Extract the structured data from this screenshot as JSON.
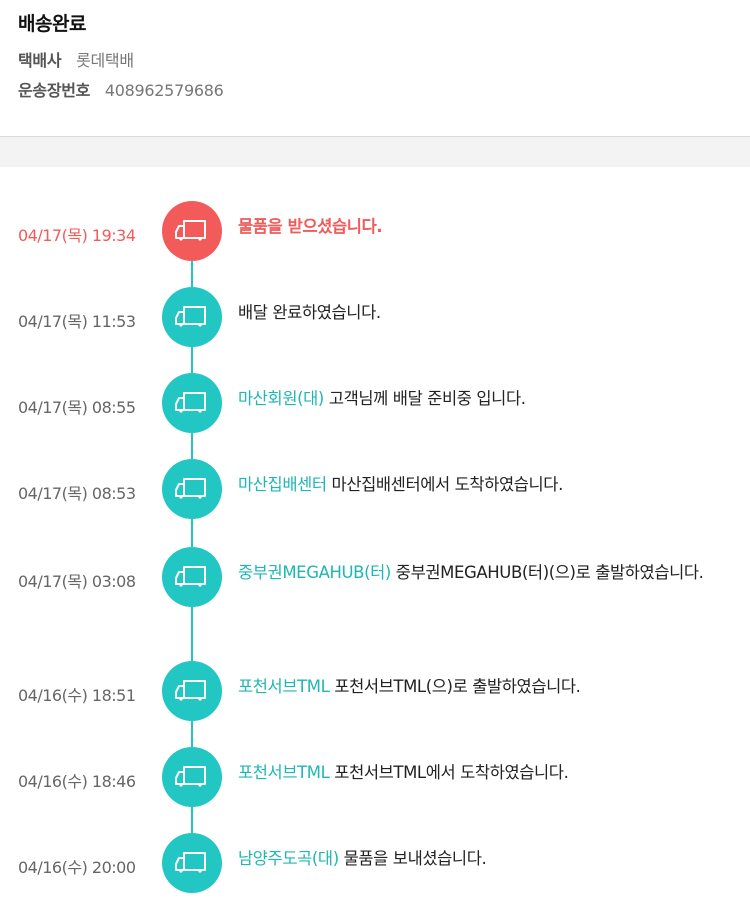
{
  "status": {
    "title": "배송완료"
  },
  "courier": {
    "label": "택배사",
    "value": "롯데택배"
  },
  "tracking": {
    "label": "운송장번호",
    "value": "408962579686"
  },
  "colors": {
    "accent": "#22c7c4",
    "location_text": "#1fb7b4",
    "active": "#f35a5a"
  },
  "events": [
    {
      "time": "04/17(목) 19:34",
      "location": "",
      "message": "물품을 받으셨습니다.",
      "active": true,
      "icon": "delivery-truck-icon"
    },
    {
      "time": "04/17(목) 11:53",
      "location": "",
      "message": "배달 완료하였습니다.",
      "active": false,
      "icon": "delivery-truck-icon"
    },
    {
      "time": "04/17(목) 08:55",
      "location": "마산회원(대)",
      "message": "고객님께 배달 준비중 입니다.",
      "active": false,
      "icon": "delivery-truck-icon"
    },
    {
      "time": "04/17(목) 08:53",
      "location": "마산집배센터",
      "message": "마산집배센터에서 도착하였습니다.",
      "active": false,
      "icon": "delivery-truck-icon"
    },
    {
      "time": "04/17(목) 03:08",
      "location": "중부권MEGAHUB(터)",
      "message": "중부권MEGAHUB(터)(으)로 출발하였습니다.",
      "active": false,
      "icon": "delivery-truck-icon"
    },
    {
      "time": "04/16(수) 18:51",
      "location": "포천서브TML",
      "message": "포천서브TML(으)로 출발하였습니다.",
      "active": false,
      "icon": "delivery-truck-icon"
    },
    {
      "time": "04/16(수) 18:46",
      "location": "포천서브TML",
      "message": "포천서브TML에서 도착하였습니다.",
      "active": false,
      "icon": "delivery-truck-icon"
    },
    {
      "time": "04/16(수) 20:00",
      "location": "남양주도곡(대)",
      "message": "물품을 보내셨습니다.",
      "active": false,
      "icon": "delivery-truck-icon"
    }
  ]
}
